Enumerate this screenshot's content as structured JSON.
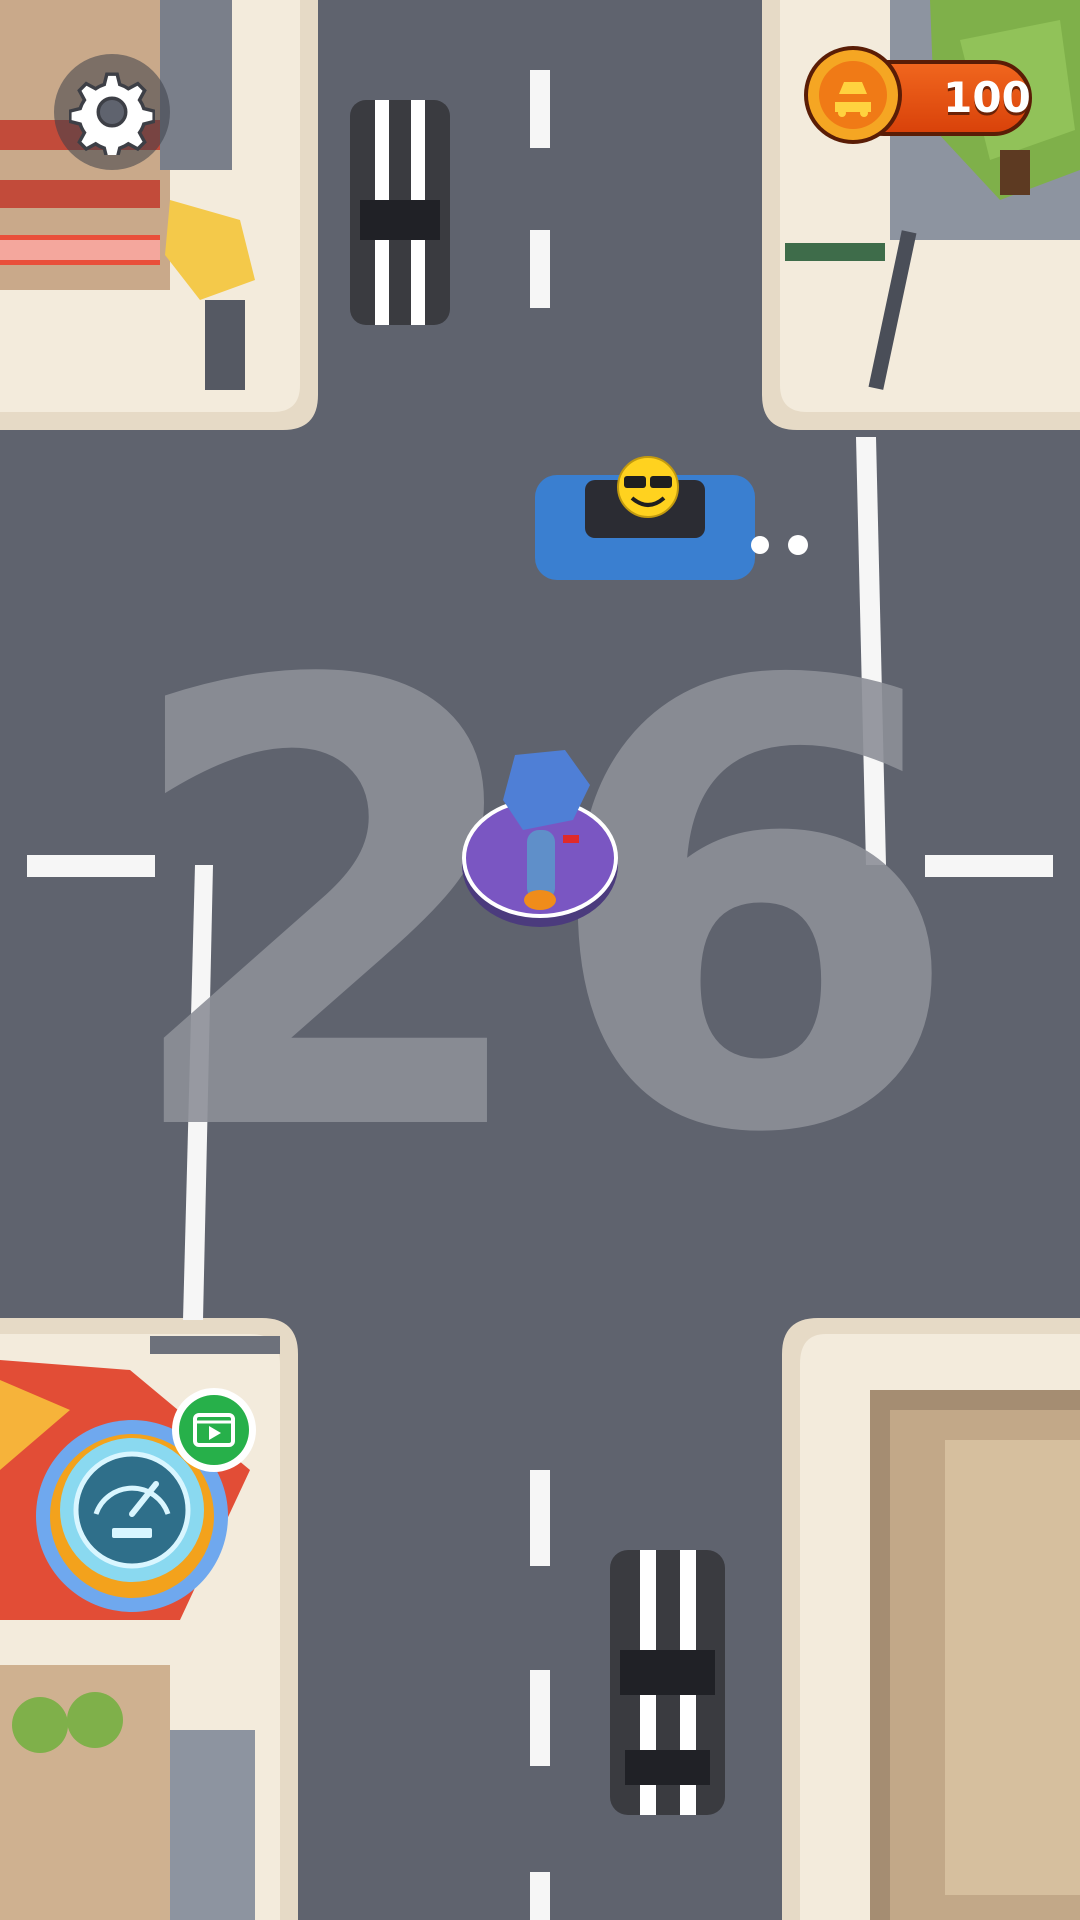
{
  "hud": {
    "settings_icon": "gear-icon",
    "coins": {
      "icon": "taxi-coin-icon",
      "value": "100"
    },
    "speed_boost": {
      "icon": "speedometer-icon",
      "ad_icon": "video-ad-icon"
    }
  },
  "level": {
    "number": "26"
  },
  "colors": {
    "road": "#5f636e",
    "sidewalk": "#efe5d3",
    "coin_orange": "#e8531a",
    "coin_gold": "#f5a623",
    "player_pad": "#7a56c2",
    "player_blue": "#4f7fd6",
    "blue_car": "#3a7fd0",
    "emoji_yellow": "#ffd21f",
    "ad_green": "#27b04a"
  }
}
